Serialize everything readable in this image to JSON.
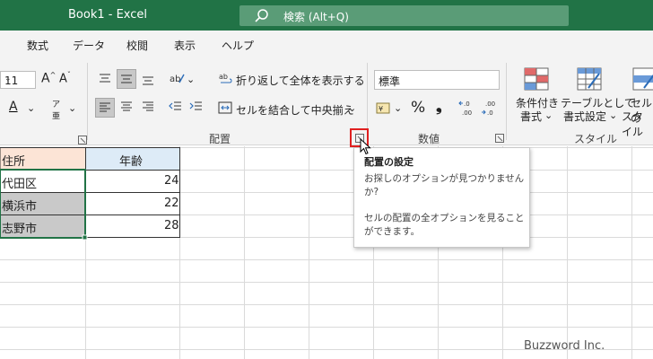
{
  "window": {
    "title": "Book1  -  Excel",
    "search_text": "検索 (Alt+Q)"
  },
  "menu": {
    "tabs": [
      "数式",
      "データ",
      "校閲",
      "表示",
      "ヘルプ"
    ]
  },
  "ribbon": {
    "font_size": "11",
    "wrap_text_label": "折り返して全体を表示する",
    "merge_center_label": "セルを結合して中央揃え",
    "group_alignment": "配置",
    "group_number": "数値",
    "group_style": "スタイル",
    "number_format": "標準",
    "percent_symbol": "%",
    "comma_symbol": "❟",
    "conditional_format_line1": "条件付き",
    "conditional_format_line2": "書式",
    "table_format_line1": "テーブルとして",
    "table_format_line2": "書式設定",
    "cell_style_line1": "セルの",
    "cell_style_line2": "スタイル"
  },
  "sheet": {
    "header_address": "住所",
    "header_age": "年齢",
    "rows": [
      {
        "address": "代田区",
        "age": "24"
      },
      {
        "address": "横浜市",
        "age": "22"
      },
      {
        "address": "志野市",
        "age": "28"
      }
    ]
  },
  "tooltip": {
    "title": "配置の設定",
    "body1_line1": "お探しのオプションが見つかりません",
    "body1_line2": "か?",
    "body2_line1": "セルの配置の全オプションを見ること",
    "body2_line2": "ができます。"
  },
  "watermark": "Buzzword Inc.",
  "colors": {
    "titlebar": "#217346",
    "header_address_fill": "#fce4d6",
    "header_age_fill": "#ddebf7",
    "selected_fill": "#c9c9c9",
    "highlight": "#e02020"
  }
}
